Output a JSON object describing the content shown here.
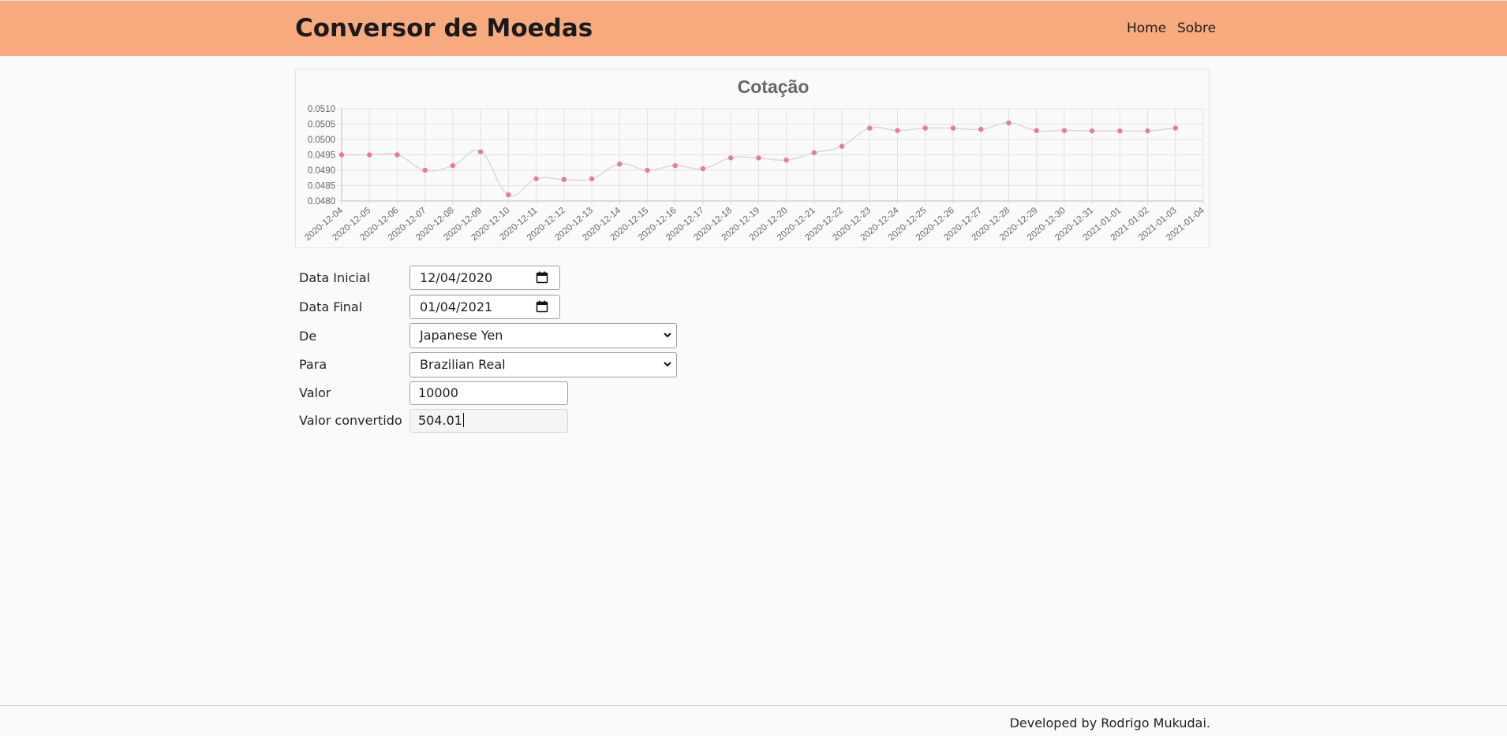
{
  "navbar": {
    "brand": "Conversor de Moedas",
    "links": [
      "Home",
      "Sobre"
    ]
  },
  "chart_data": {
    "type": "line",
    "title": "Cotação",
    "xlabel": "",
    "ylabel": "",
    "x": [
      "2020-12-04",
      "2020-12-05",
      "2020-12-06",
      "2020-12-07",
      "2020-12-08",
      "2020-12-09",
      "2020-12-10",
      "2020-12-11",
      "2020-12-12",
      "2020-12-13",
      "2020-12-14",
      "2020-12-15",
      "2020-12-16",
      "2020-12-17",
      "2020-12-18",
      "2020-12-19",
      "2020-12-20",
      "2020-12-21",
      "2020-12-22",
      "2020-12-23",
      "2020-12-24",
      "2020-12-25",
      "2020-12-26",
      "2020-12-27",
      "2020-12-28",
      "2020-12-29",
      "2020-12-30",
      "2020-12-31",
      "2021-01-01",
      "2021-01-02",
      "2021-01-03",
      "2021-01-04"
    ],
    "series": [
      {
        "values": [
          0.0495,
          0.0495,
          0.0495,
          0.049,
          0.04915,
          0.0496,
          0.0482,
          0.04872,
          0.0487,
          0.04872,
          0.0492,
          0.049,
          0.04915,
          0.04905,
          0.0494,
          0.0494,
          0.04933,
          0.04957,
          0.04978,
          0.05037,
          0.05029,
          0.05037,
          0.05037,
          0.05033,
          0.05054,
          0.05029,
          0.05029,
          0.05028,
          0.05028,
          0.05028,
          0.05037,
          null
        ],
        "color": "#e57f8c"
      }
    ],
    "y_ticks": [
      "0.0480",
      "0.0485",
      "0.0490",
      "0.0495",
      "0.0500",
      "0.0505",
      "0.0510"
    ],
    "ylim": [
      0.048,
      0.051
    ],
    "grid": true,
    "line_color": "#d9d9d9",
    "point_color": "#e57f8c"
  },
  "form": {
    "data_inicial": {
      "label": "Data Inicial",
      "value": "12/04/2020"
    },
    "data_final": {
      "label": "Data Final",
      "value": "01/04/2021"
    },
    "de": {
      "label": "De",
      "value": "Japanese Yen"
    },
    "para": {
      "label": "Para",
      "value": "Brazilian Real"
    },
    "valor": {
      "label": "Valor",
      "value": "10000"
    },
    "valor_convertido": {
      "label": "Valor convertido",
      "value": "504.01"
    }
  },
  "footer": {
    "text": "Developed by Rodrigo Mukudai."
  },
  "colors": {
    "navbar": "#f7aa7e",
    "background": "#fafafa"
  }
}
